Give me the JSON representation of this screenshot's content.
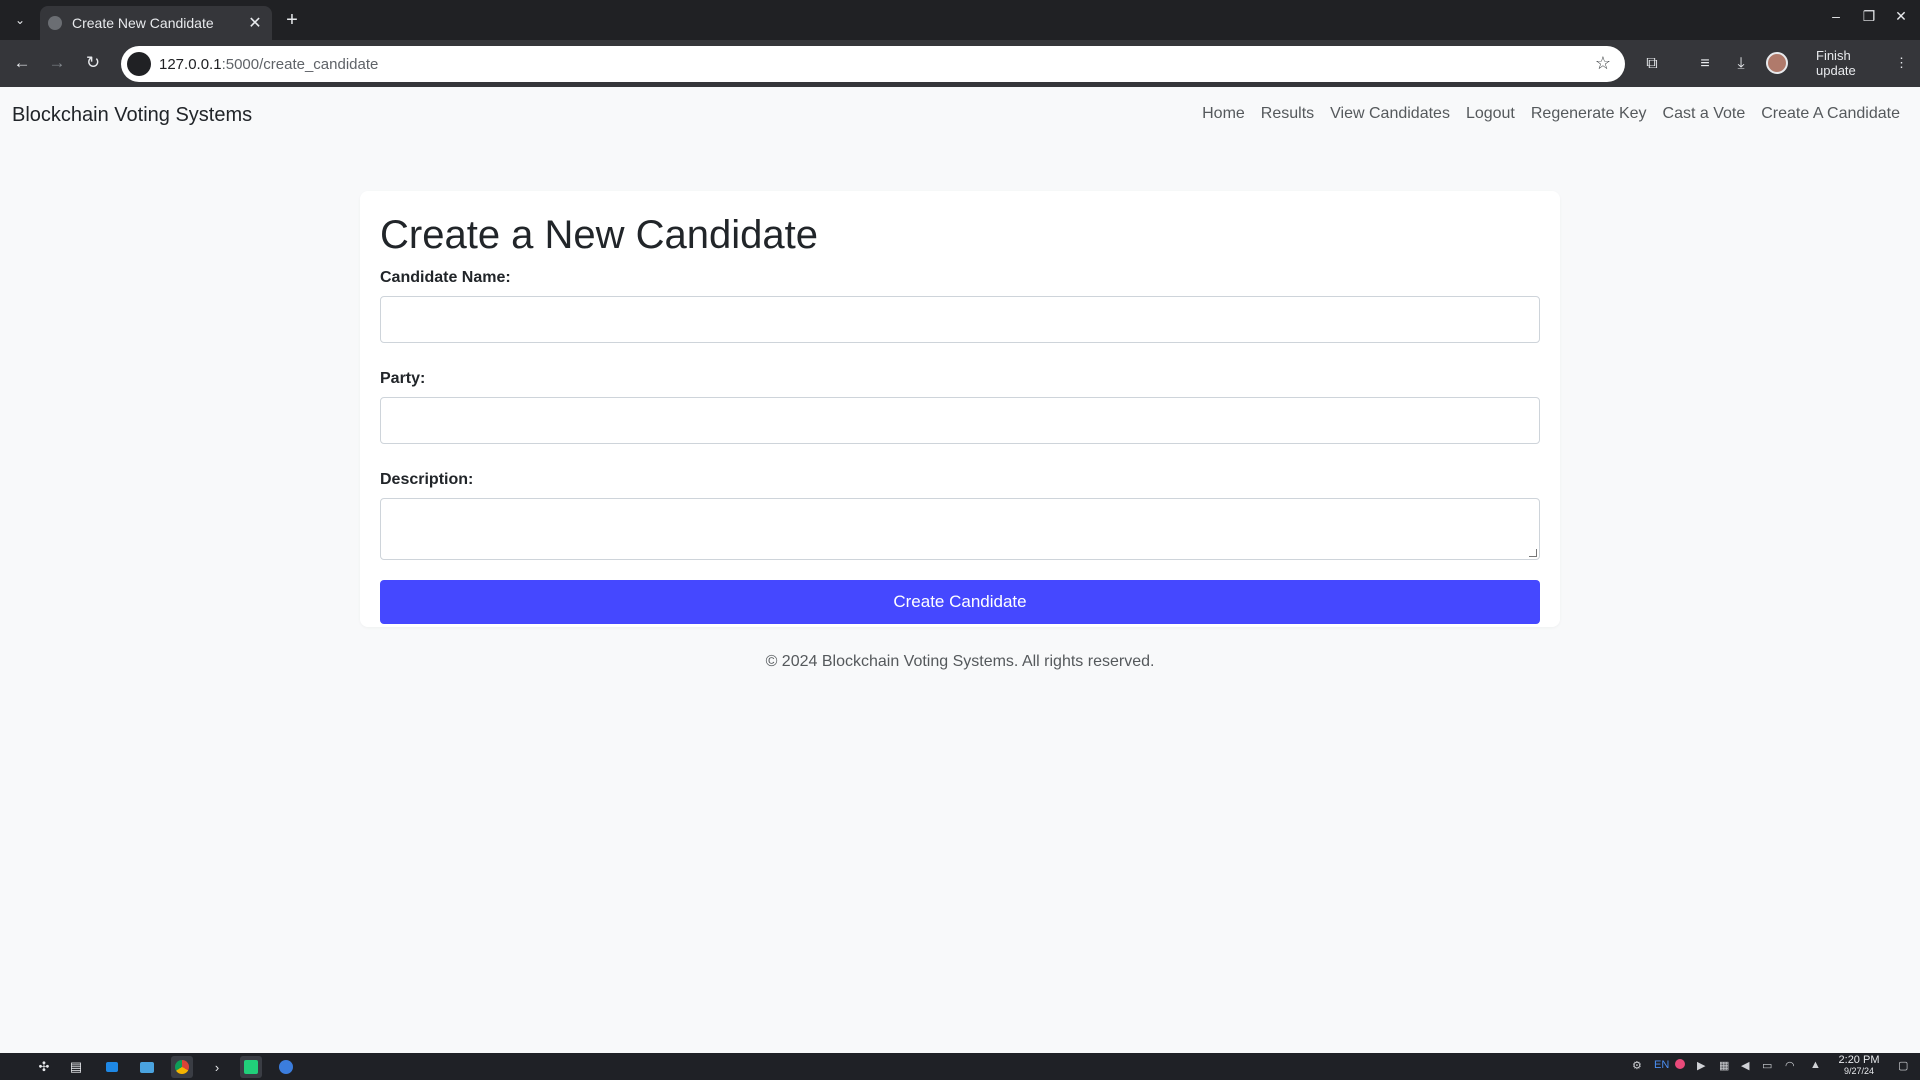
{
  "browser": {
    "tab_title": "Create New Candidate",
    "url_host": "127.0.0.1",
    "url_path": ":5000/create_candidate",
    "finish_update_label": "Finish update"
  },
  "navbar": {
    "brand": "Blockchain Voting Systems",
    "links": [
      "Home",
      "Results",
      "View Candidates",
      "Logout",
      "Regenerate Key",
      "Cast a Vote",
      "Create A Candidate"
    ]
  },
  "form": {
    "heading": "Create a New Candidate",
    "name_label": "Candidate Name:",
    "name_value": "",
    "party_label": "Party:",
    "party_value": "",
    "description_label": "Description:",
    "description_value": "",
    "submit_label": "Create Candidate"
  },
  "footer": {
    "text": "© 2024 Blockchain Voting Systems. All rights reserved."
  },
  "taskbar": {
    "language": "EN",
    "time": "2:20 PM",
    "date": "9/27/24"
  },
  "colors": {
    "accent": "#4548ff",
    "page_background": "#f8f9fa",
    "browser_frame": "#202124"
  }
}
